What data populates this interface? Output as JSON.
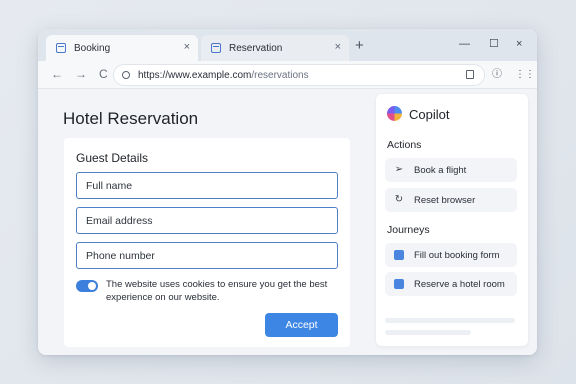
{
  "tabs": [
    {
      "label": "Booking",
      "active": true,
      "close": "×"
    },
    {
      "label": "Reservation",
      "active": false,
      "close": "×"
    }
  ],
  "new_tab": "+",
  "window_controls": {
    "minimize": "—",
    "maximize": "☐",
    "close": "×"
  },
  "nav": {
    "back": "←",
    "forward": "→",
    "reload": "C"
  },
  "address": {
    "host": "https://www.example.com",
    "path": "/reservations"
  },
  "toolbar_icons": {
    "info": "ⓘ",
    "menu": "⋮⋮"
  },
  "page": {
    "title": "Hotel Reservation"
  },
  "form": {
    "title": "Guest Details",
    "fields": [
      {
        "placeholder": "Full name"
      },
      {
        "placeholder": "Email address"
      },
      {
        "placeholder": "Phone number"
      }
    ],
    "cookie_text": "The website uses cookies to ensure you get the best experience on our website.",
    "cookie_toggle_on": true,
    "accept_label": "Accept"
  },
  "copilot": {
    "title": "Copilot",
    "actions_heading": "Actions",
    "actions": [
      {
        "label": "Book a flight",
        "icon": "send-icon"
      },
      {
        "label": "Reset browser",
        "icon": "refresh-icon"
      }
    ],
    "journeys_heading": "Journeys",
    "journeys": [
      {
        "label": "Fill out booking form",
        "icon": "form-icon"
      },
      {
        "label": "Reserve a hotel room",
        "icon": "hotel-icon"
      }
    ]
  },
  "colors": {
    "accent": "#3e86e4",
    "field_border": "#4f7fc4",
    "page_bg": "#f2f4f7"
  }
}
